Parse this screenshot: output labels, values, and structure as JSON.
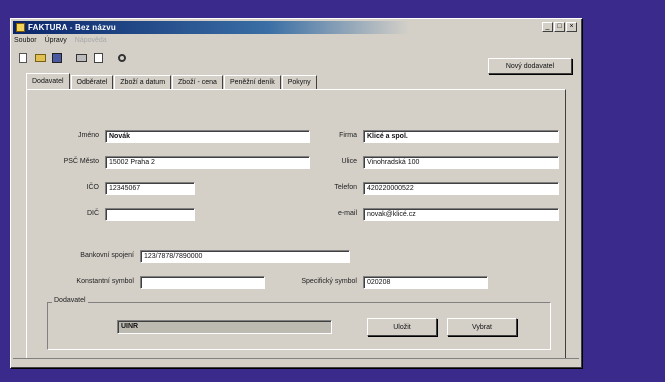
{
  "window": {
    "title": "FAKTURA - Bez názvu"
  },
  "menu": [
    {
      "label": "Soubor",
      "disabled": false
    },
    {
      "label": "Úpravy",
      "disabled": false
    },
    {
      "label": "Nápověda",
      "disabled": true
    }
  ],
  "toolbar": {
    "icons": [
      "new-document-icon",
      "open-folder-icon",
      "save-icon",
      "print-icon",
      "print-preview-icon",
      "find-icon"
    ],
    "new_supplier_label": "Nový dodavatel"
  },
  "tabs": [
    "Dodavatel",
    "Odběratel",
    "Zboží a datum",
    "Zboží - cena",
    "Peněžní deník",
    "Pokyny"
  ],
  "form": {
    "jmeno_label": "Jméno",
    "jmeno_value": "Novák",
    "psc_label": "PSČ Město",
    "psc_value": "15002 Praha 2",
    "ico_label": "IČO",
    "ico_value": "12345067",
    "dic_label": "DIČ",
    "dic_value": "",
    "firma_label": "Firma",
    "firma_value": "Klicé a spol.",
    "ulice_label": "Ulice",
    "ulice_value": "Vinohradská 100",
    "telefon_label": "Telefon",
    "telefon_value": "420220000522",
    "email_label": "e-mail",
    "email_value": "novak@klicé.cz",
    "bank_label": "Bankovní spojení",
    "bank_value": "123/7878/7890000",
    "konst_label": "Konstantní symbol",
    "konst_value": "",
    "spec_label": "Specifický symbol",
    "spec_value": "020208"
  },
  "supplier_group": {
    "title": "Dodavatel",
    "value": "UINR",
    "save_label": "Uložit",
    "select_label": "Vybrat"
  },
  "window_controls": {
    "minimize": "_",
    "maximize": "□",
    "close": "×"
  }
}
